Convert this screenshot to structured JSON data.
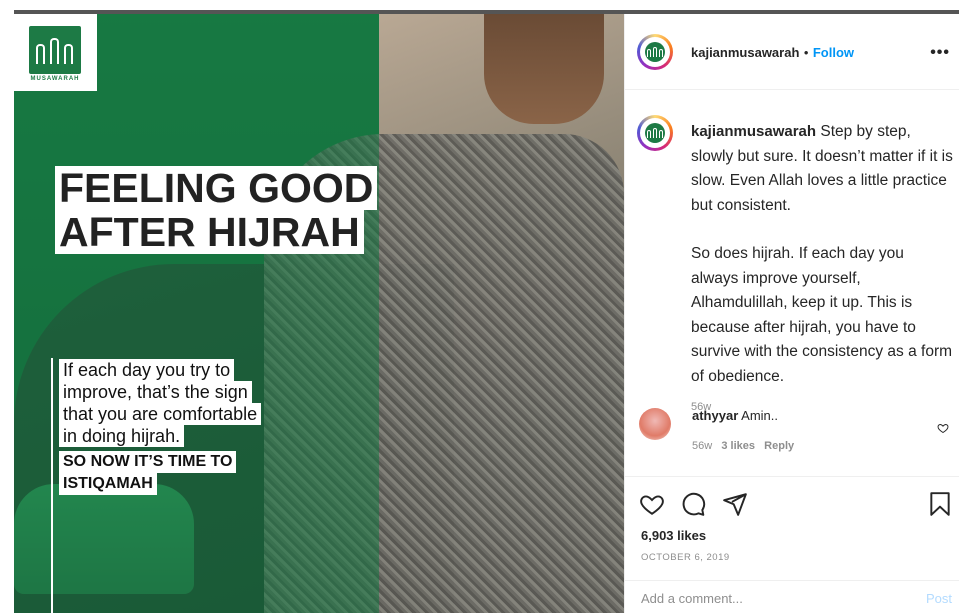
{
  "post": {
    "logo_text": "MUSAWARAH",
    "headline": [
      "FEELING GOOD",
      "AFTER HIJRAH"
    ],
    "body_lines": [
      "If each day you try to",
      "improve, that’s the sign",
      "that you are comfortable",
      "in doing hijrah."
    ],
    "cta_lines": [
      "SO NOW IT’S TIME TO",
      "ISTIQAMAH"
    ],
    "colors": {
      "brand_green": "#1d7a45",
      "follow_blue": "#0095f6"
    }
  },
  "header": {
    "username": "kajianmusawarah",
    "separator": "•",
    "follow_label": "Follow",
    "more_icon": "more-horizontal-icon",
    "more_label": "•••"
  },
  "caption": {
    "username": "kajianmusawarah",
    "paragraph1": " Step by step, slowly but sure. It doesn’t matter if it is slow. Even Allah loves a little practice but consistent.",
    "paragraph2": "So does hijrah. If each day you always improve yourself, Alhamdulillah, keep it up. This is because after hijrah, you have to survive with the consistency as a form of obedience.",
    "time": "56w"
  },
  "comments": [
    {
      "username": "athyyar",
      "text": " Amin..",
      "time": "56w",
      "likes": "3 likes",
      "reply_label": "Reply"
    }
  ],
  "actions": {
    "icons": [
      "heart-icon",
      "comment-icon",
      "share-icon",
      "bookmark-icon"
    ],
    "likes": "6,903 likes",
    "date": "OCTOBER 6, 2019"
  },
  "add_comment": {
    "placeholder": "Add a comment...",
    "post_label": "Post"
  }
}
